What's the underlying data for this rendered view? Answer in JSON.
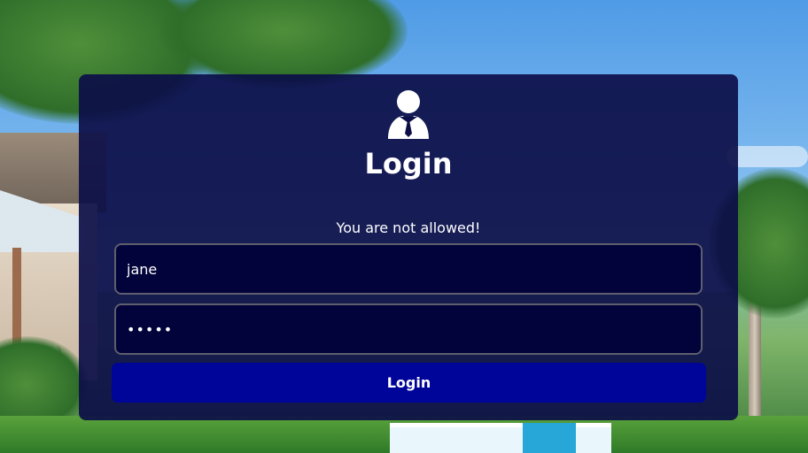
{
  "login": {
    "icon": "user-businessman-icon",
    "title": "Login",
    "message": "You are not allowed!",
    "username_value": "jane",
    "password_value": "jane1",
    "button_label": "Login"
  },
  "colors": {
    "card_background": "#0c0e48",
    "input_background": "#02033a",
    "button_background": "#00059a",
    "text": "#ffffff"
  }
}
